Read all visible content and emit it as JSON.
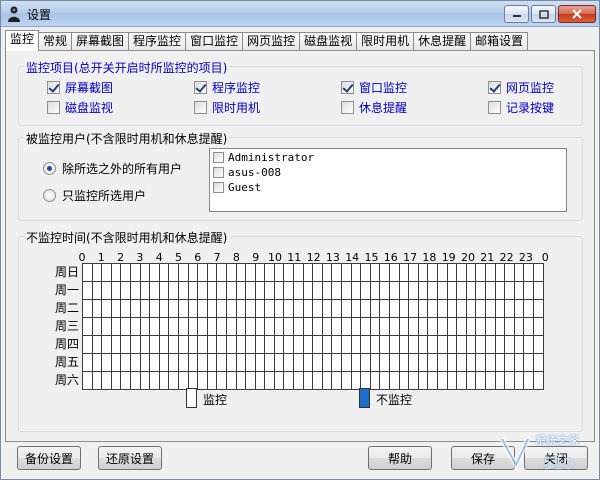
{
  "window": {
    "title": "设置"
  },
  "tabs": [
    "监控",
    "常规",
    "屏幕截图",
    "程序监控",
    "窗口监控",
    "网页监控",
    "磁盘监视",
    "限时用机",
    "休息提醒",
    "邮箱设置"
  ],
  "active_tab": "监控",
  "monitor_items": {
    "title": "监控项目(总开关开启时所监控的项目)",
    "items": [
      {
        "label": "屏幕截图",
        "checked": true
      },
      {
        "label": "程序监控",
        "checked": true
      },
      {
        "label": "窗口监控",
        "checked": true
      },
      {
        "label": "网页监控",
        "checked": true
      },
      {
        "label": "磁盘监视",
        "checked": false
      },
      {
        "label": "限时用机",
        "checked": false
      },
      {
        "label": "休息提醒",
        "checked": false
      },
      {
        "label": "记录按键",
        "checked": false
      }
    ]
  },
  "monitored_users": {
    "title": "被监控用户(不含限时用机和休息提醒)",
    "options": [
      {
        "label": "除所选之外的所有用户",
        "selected": true
      },
      {
        "label": "只监控所选用户",
        "selected": false
      }
    ],
    "users": [
      {
        "name": "Administrator",
        "checked": false
      },
      {
        "name": "asus-008",
        "checked": false
      },
      {
        "name": "Guest",
        "checked": false
      }
    ]
  },
  "no_monitor_time": {
    "title": "不监控时间(不含限时用机和休息提醒)",
    "hours": [
      "0",
      "1",
      "2",
      "3",
      "4",
      "5",
      "6",
      "7",
      "8",
      "9",
      "10",
      "11",
      "12",
      "13",
      "14",
      "15",
      "16",
      "17",
      "18",
      "19",
      "20",
      "21",
      "22",
      "23",
      "0"
    ],
    "days": [
      "周日",
      "周一",
      "周二",
      "周三",
      "周四",
      "周五",
      "周六"
    ],
    "legend": [
      {
        "label": "监控",
        "color": "#ffffff"
      },
      {
        "label": "不监控",
        "color": "#1c6fc9"
      }
    ]
  },
  "buttons": {
    "backup": "备份设置",
    "restore": "还原设置",
    "help": "帮助",
    "save": "保存",
    "close": "关闭"
  },
  "watermark": "系统之家"
}
